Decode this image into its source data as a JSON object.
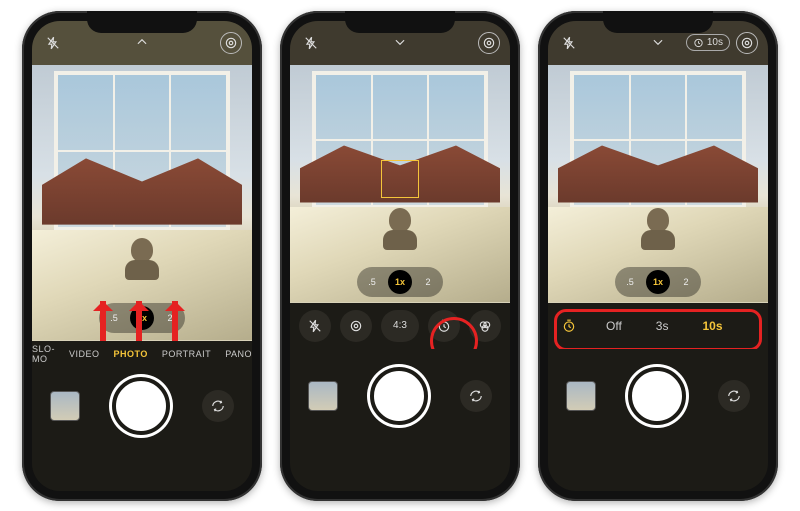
{
  "annotations": {
    "accent": "#e52222"
  },
  "phone1": {
    "chevron_dir": "up",
    "zoom": {
      "options": [
        ".5",
        "1x",
        "2"
      ],
      "active": 1
    },
    "modes": {
      "items": [
        "SLO-MO",
        "VIDEO",
        "PHOTO",
        "PORTRAIT",
        "PANO"
      ],
      "active": 2
    }
  },
  "phone2": {
    "chevron_dir": "down",
    "zoom": {
      "options": [
        ".5",
        "1x",
        "2"
      ],
      "active": 1
    },
    "toolbar": {
      "flash": "flash",
      "live": "live",
      "ratio_label": "4:3",
      "timer": "timer",
      "filters": "filters"
    }
  },
  "phone3": {
    "chevron_dir": "down",
    "timer_badge": "10s",
    "zoom": {
      "options": [
        ".5",
        "1x",
        "2"
      ],
      "active": 1
    },
    "timer_options": {
      "items": [
        "Off",
        "3s",
        "10s"
      ],
      "active": 2
    }
  }
}
